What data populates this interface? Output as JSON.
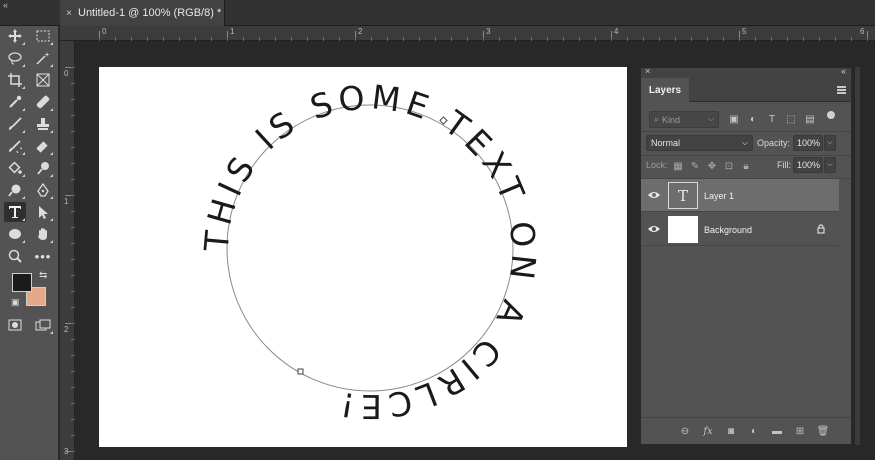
{
  "document": {
    "tab_title": "Untitled-1 @ 100% (RGB/8) *",
    "close_glyph": "×"
  },
  "rulers": {
    "top": [
      "0",
      "1",
      "2",
      "3",
      "4",
      "5",
      "6"
    ],
    "left": [
      "0",
      "1",
      "2",
      "3"
    ]
  },
  "canvas": {
    "text_on_path": "THIS IS SOME TEXT ON A CIRLCE!",
    "background": "#ffffff",
    "text_color": "#1a1a1a"
  },
  "colors": {
    "foreground": "#1b1b1b",
    "background": "#e3a98a"
  },
  "layers_panel": {
    "tab_label": "Layers",
    "kind_placeholder": "Kind",
    "blend_mode": "Normal",
    "opacity_label": "Opacity:",
    "opacity_value": "100%",
    "lock_label": "Lock:",
    "fill_label": "Fill:",
    "fill_value": "100%",
    "layers": [
      {
        "name": "Layer 1",
        "type": "text",
        "selected": true,
        "thumb_glyph": "T"
      },
      {
        "name": "Background",
        "type": "pixel",
        "selected": false,
        "locked": true
      }
    ]
  }
}
